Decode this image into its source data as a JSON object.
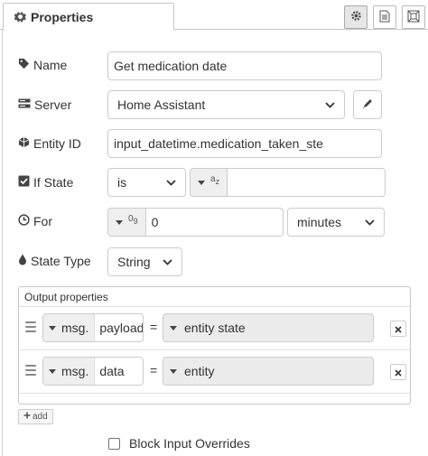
{
  "header": {
    "tab_label": "Properties",
    "tab_icon": "gear-icon",
    "buttons": [
      "gear-icon",
      "description-icon",
      "appearance-icon"
    ]
  },
  "fields": {
    "name": {
      "label": "Name",
      "value": "Get medication date"
    },
    "server": {
      "label": "Server",
      "value": "Home Assistant"
    },
    "entity_id": {
      "label": "Entity ID",
      "value": "input_datetime.medication_taken_ste"
    },
    "if_state": {
      "label": "If State",
      "operator": "is",
      "type_glyph_top": "a",
      "type_glyph_sub": "z",
      "value": ""
    },
    "for": {
      "label": "For",
      "type_glyph_top": "0",
      "type_glyph_sub": "9",
      "value": "0",
      "unit": "minutes"
    },
    "state_type": {
      "label": "State Type",
      "value": "String"
    }
  },
  "output": {
    "title": "Output properties",
    "rows": [
      {
        "prefix": "msg.",
        "property": "payload",
        "equals": "=",
        "value": "entity state"
      },
      {
        "prefix": "msg.",
        "property": "data",
        "equals": "=",
        "value": "entity"
      }
    ],
    "add_label": "add"
  },
  "block_input": {
    "label": "Block Input Overrides",
    "checked": false
  },
  "colors": {
    "border": "#cccccc",
    "typed_bg": "#efefef",
    "text": "#333333"
  }
}
